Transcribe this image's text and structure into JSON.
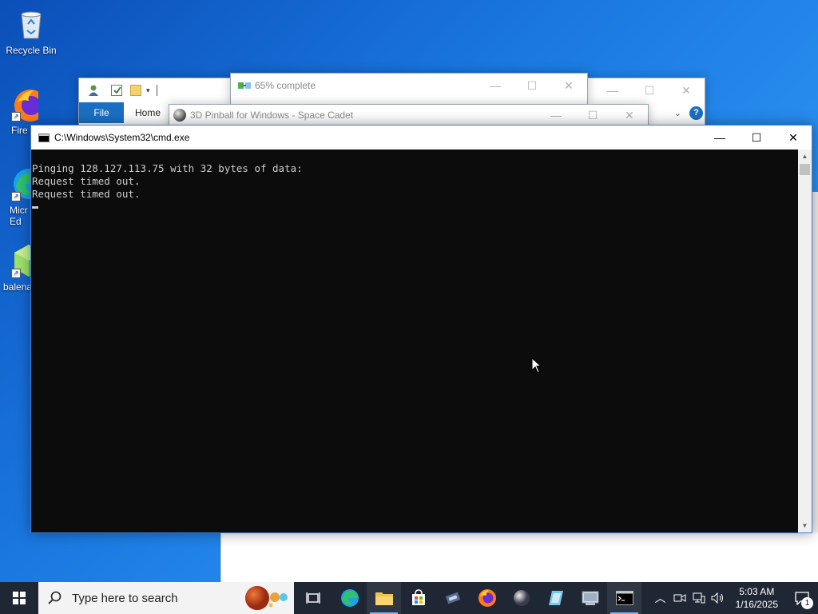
{
  "desktop": {
    "icons": [
      {
        "label": "Recycle Bin"
      },
      {
        "label": "Fire"
      },
      {
        "label": "Micr Ed"
      },
      {
        "label": "balena"
      }
    ]
  },
  "explorer": {
    "tabs": {
      "file": "File",
      "home": "Home"
    }
  },
  "progress_dialog": {
    "title": "65% complete"
  },
  "pinball": {
    "title": "3D Pinball for Windows - Space Cadet"
  },
  "cmd": {
    "title": "C:\\Windows\\System32\\cmd.exe",
    "lines": [
      "Pinging 128.127.113.75 with 32 bytes of data:",
      "Request timed out.",
      "Request timed out."
    ]
  },
  "taskbar": {
    "search_placeholder": "Type here to search",
    "time": "5:03 AM",
    "date": "1/16/2025",
    "notification_count": "1",
    "apps": [
      "task-view",
      "edge",
      "file-explorer",
      "store",
      "app",
      "firefox",
      "pinball",
      "app2",
      "app3",
      "cmd"
    ]
  },
  "colors": {
    "desktop": "#1a78e0",
    "taskbar": "#1f2735",
    "cmd_bg": "#0c0c0c",
    "cmd_text": "#cccccc",
    "ribbon_file": "#1a6fc3"
  }
}
